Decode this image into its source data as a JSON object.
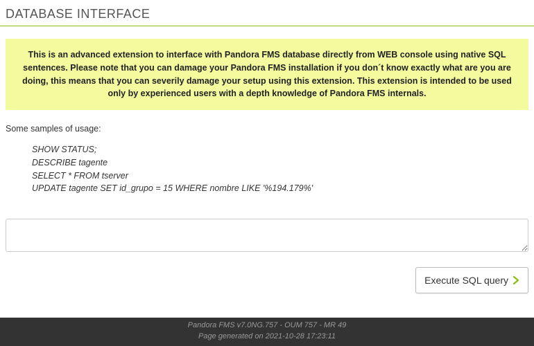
{
  "header": {
    "title": "DATABASE INTERFACE"
  },
  "warning": {
    "text": "This is an advanced extension to interface with Pandora FMS database directly from WEB console using native SQL sentences. Please note that you can damage your Pandora FMS installation if you don´t know exactly what are you are doing, this means that you can severily damage your setup using this extension. This extension is intended to be used only by experienced users with a depth knowledge of Pandora FMS internals."
  },
  "samples": {
    "label": "Some samples of usage:",
    "examples": [
      "SHOW STATUS;",
      "DESCRIBE tagente",
      "SELECT * FROM tserver",
      "UPDATE tagente SET id_grupo = 15 WHERE nombre LIKE '%194.179%'"
    ]
  },
  "sql": {
    "value": "",
    "placeholder": ""
  },
  "actions": {
    "execute_label": "Execute SQL query"
  },
  "footer": {
    "line1": "Pandora FMS v7.0NG.757 - OUM 757 - MR 49",
    "line2": "Page generated on 2021-10-28 17:23:11"
  },
  "colors": {
    "accent": "#8abf15",
    "warning_bg": "#f4fb9f"
  }
}
